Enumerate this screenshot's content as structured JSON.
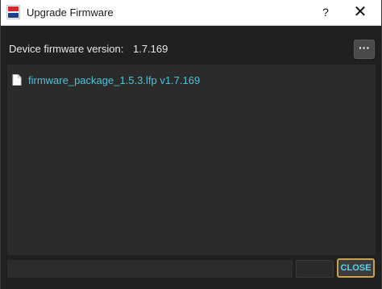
{
  "window": {
    "title": "Upgrade Firmware",
    "help_label": "?",
    "close_label": "✕"
  },
  "device": {
    "version_label": "Device firmware version:",
    "version_value": "1.7.169",
    "more_label": "···"
  },
  "files": [
    {
      "name": "firmware_package_1.5.3.lfp v1.7.169",
      "icon": "file-icon"
    }
  ],
  "footer": {
    "disabled_button_label": "",
    "close_button_label": "CLOSE"
  },
  "colors": {
    "accent_text": "#4ec3d6",
    "close_border": "#c7a24a",
    "background": "#202020"
  }
}
